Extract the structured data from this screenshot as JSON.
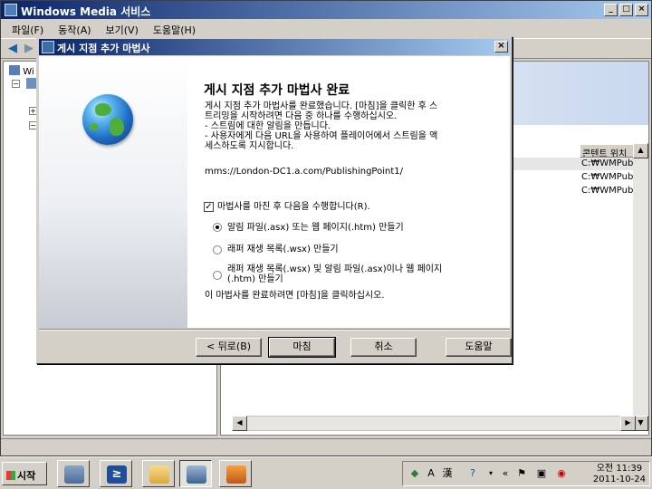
{
  "main_window": {
    "title": "Windows Media 서비스",
    "menu": [
      "파일(F)",
      "동작(A)",
      "보기(V)",
      "도움말(H)"
    ],
    "tree": [
      {
        "label": "Wi"
      },
      {
        "label": ""
      }
    ],
    "list": {
      "column_header": "콘텐트 위치",
      "rows": [
        "C:₩WMPub",
        "C:₩WMPub",
        "C:₩WMPub"
      ]
    }
  },
  "dialog": {
    "title": "게시 지점 추가 마법사",
    "heading": "게시 지점 추가 마법사 완료",
    "description_lines": [
      "게시 지점 추가 마법사를 완료했습니다. [마침]을 클릭한 후 스",
      "트리밍을 시작하려면 다음 중 하나를 수행하십시오.",
      "- 스트림에 대한 알림을 만듭니다.",
      "- 사용자에게 다음 URL을 사용하여 플레이어에서 스트림을 액",
      "세스하도록 지시합니다."
    ],
    "url": "mms://London-DC1.a.com/PublishingPoint1/",
    "checkbox_label": "마법사를 마친 후 다음을 수행합니다(R).",
    "checkbox_checked": true,
    "options": [
      {
        "label_lines": [
          "알림 파일(.asx) 또는 웹 페이지(.htm) 만들기"
        ],
        "selected": true
      },
      {
        "label_lines": [
          "래퍼 재생 목록(.wsx) 만들기"
        ],
        "selected": false
      },
      {
        "label_lines": [
          "래퍼 재생 목록(.wsx) 및 알림 파일(.asx)이나 웹 페이지",
          "(.htm) 만들기"
        ],
        "selected": false
      }
    ],
    "footer_text": "이 마법사를 완료하려면 [마침]을 클릭하십시오.",
    "buttons": {
      "back": "< 뒤로(B)",
      "finish": "마침",
      "cancel": "취소",
      "help": "도움말"
    }
  },
  "taskbar": {
    "start_label": "시작",
    "tray": {
      "ime_mode": "A",
      "ime_hanja": "漢",
      "time": "오전 11:39",
      "date": "2011-10-24"
    }
  },
  "colors": {
    "title_active": "#0a246a",
    "title_gradient_end": "#a6caf0",
    "face": "#d4d0c8"
  }
}
